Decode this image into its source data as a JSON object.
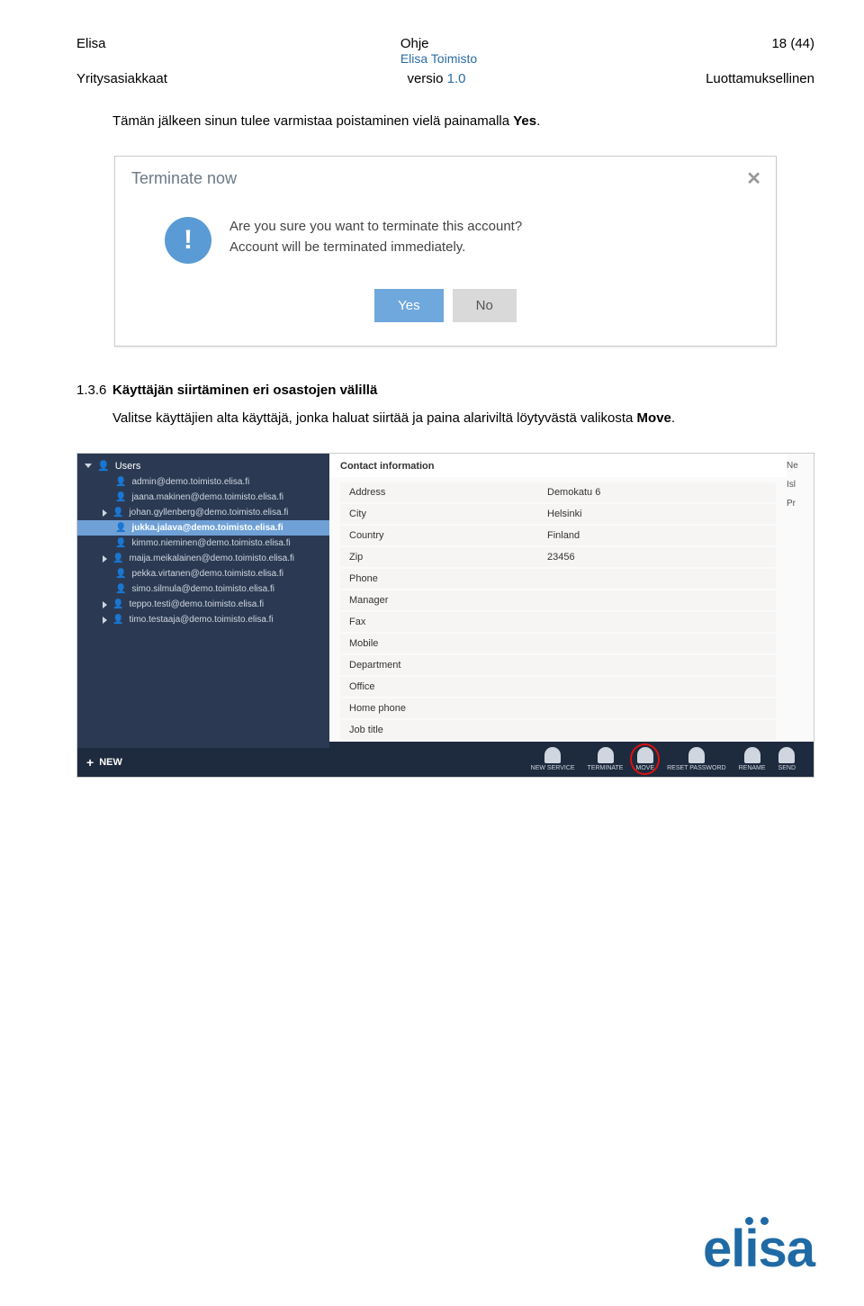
{
  "header": {
    "company": "Elisa",
    "doc_type": "Ohje",
    "page": "18 (44)",
    "product": "Elisa Toimisto",
    "audience": "Yritysasiakkaat",
    "version_label": "versio ",
    "version_num": "1.0",
    "confidential": "Luottamuksellinen"
  },
  "intro_text_1": "Tämän jälkeen sinun tulee varmistaa poistaminen vielä painamalla ",
  "intro_text_2": "Yes",
  "intro_text_3": ".",
  "modal": {
    "title": "Terminate now",
    "line1": "Are you sure you want to terminate this account?",
    "line2": "Account will be terminated immediately.",
    "yes": "Yes",
    "no": "No"
  },
  "section": {
    "num": "1.3.6",
    "title": "Käyttäjän siirtäminen eri osastojen välillä",
    "body_1": "Valitse käyttäjien alta käyttäjä, jonka haluat siirtää ja paina alariviltä löytyvästä valikosta ",
    "body_2": "Move",
    "body_3": "."
  },
  "sidebar": {
    "root": "Users",
    "items": [
      {
        "label": "admin@demo.toimisto.elisa.fi",
        "expandable": false
      },
      {
        "label": "jaana.makinen@demo.toimisto.elisa.fi",
        "expandable": false
      },
      {
        "label": "johan.gyllenberg@demo.toimisto.elisa.fi",
        "expandable": true
      },
      {
        "label": "jukka.jalava@demo.toimisto.elisa.fi",
        "expandable": false,
        "selected": true
      },
      {
        "label": "kimmo.nieminen@demo.toimisto.elisa.fi",
        "expandable": false
      },
      {
        "label": "maija.meikalainen@demo.toimisto.elisa.fi",
        "expandable": true
      },
      {
        "label": "pekka.virtanen@demo.toimisto.elisa.fi",
        "expandable": false
      },
      {
        "label": "simo.silmula@demo.toimisto.elisa.fi",
        "expandable": false
      },
      {
        "label": "teppo.testi@demo.toimisto.elisa.fi",
        "expandable": true
      },
      {
        "label": "timo.testaaja@demo.toimisto.elisa.fi",
        "expandable": true
      }
    ],
    "new": "NEW"
  },
  "contact": {
    "heading": "Contact information",
    "fields": [
      {
        "label": "Address",
        "value": "Demokatu 6"
      },
      {
        "label": "City",
        "value": "Helsinki"
      },
      {
        "label": "Country",
        "value": "Finland"
      },
      {
        "label": "Zip",
        "value": "23456"
      },
      {
        "label": "Phone",
        "value": ""
      },
      {
        "label": "Manager",
        "value": ""
      },
      {
        "label": "Fax",
        "value": ""
      },
      {
        "label": "Mobile",
        "value": ""
      },
      {
        "label": "Department",
        "value": ""
      },
      {
        "label": "Office",
        "value": ""
      },
      {
        "label": "Home phone",
        "value": ""
      },
      {
        "label": "Job title",
        "value": ""
      }
    ]
  },
  "rightcol": [
    "Ne",
    "Isl",
    "Pr"
  ],
  "toolbar": [
    {
      "label": "NEW SERVICE",
      "name": "new-service"
    },
    {
      "label": "TERMINATE",
      "name": "terminate"
    },
    {
      "label": "MOVE",
      "name": "move",
      "highlight": true
    },
    {
      "label": "RESET PASSWORD",
      "name": "reset-password"
    },
    {
      "label": "RENAME",
      "name": "rename"
    },
    {
      "label": "SEND",
      "name": "send"
    }
  ],
  "logo": "elisa"
}
